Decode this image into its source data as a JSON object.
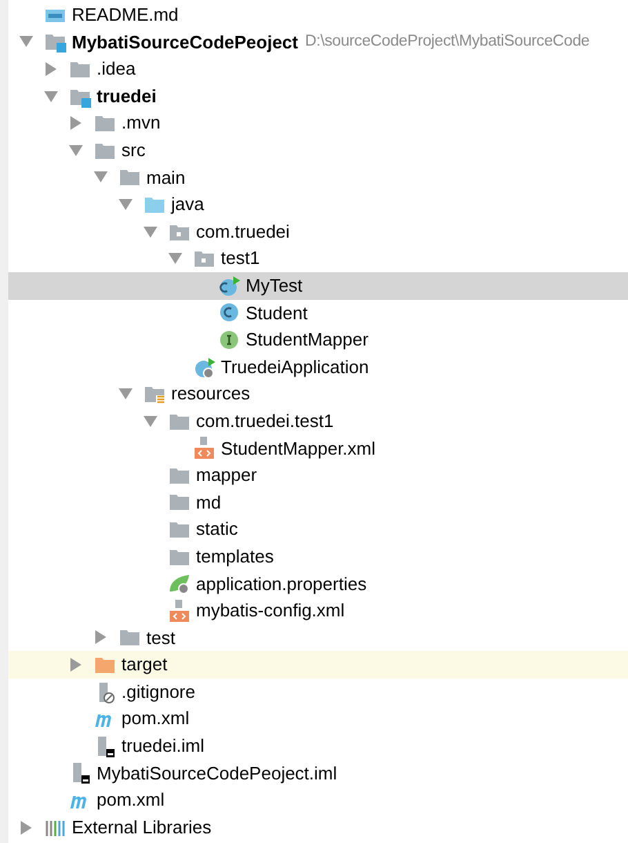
{
  "tree": [
    {
      "label": "README.md",
      "kind": "md-file",
      "selected": false,
      "highlighted": false
    },
    {
      "label": "MybatiSourceCodePeoject",
      "hint": "D:\\sourceCodeProject\\MybatiSourceCode",
      "kind": "module",
      "expanded": true,
      "selected": false,
      "highlighted": false,
      "children": [
        {
          "label": ".idea",
          "kind": "folder",
          "expanded": false,
          "selected": false,
          "highlighted": false
        },
        {
          "label": "truedei",
          "kind": "module",
          "expanded": true,
          "selected": false,
          "highlighted": false,
          "children": [
            {
              "label": ".mvn",
              "kind": "folder",
              "expanded": false,
              "selected": false,
              "highlighted": false
            },
            {
              "label": "src",
              "kind": "folder",
              "expanded": true,
              "selected": false,
              "highlighted": false,
              "children": [
                {
                  "label": "main",
                  "kind": "folder",
                  "expanded": true,
                  "selected": false,
                  "highlighted": false,
                  "children": [
                    {
                      "label": "java",
                      "kind": "source-folder",
                      "expanded": true,
                      "selected": false,
                      "highlighted": false,
                      "children": [
                        {
                          "label": "com.truedei",
                          "kind": "package",
                          "expanded": true,
                          "selected": false,
                          "highlighted": false,
                          "children": [
                            {
                              "label": "test1",
                              "kind": "package",
                              "expanded": true,
                              "selected": false,
                              "highlighted": false,
                              "children": [
                                {
                                  "label": "MyTest",
                                  "kind": "runnable-class",
                                  "selected": true,
                                  "highlighted": false
                                },
                                {
                                  "label": "Student",
                                  "kind": "class",
                                  "selected": false,
                                  "highlighted": false
                                },
                                {
                                  "label": "StudentMapper",
                                  "kind": "interface",
                                  "selected": false,
                                  "highlighted": false
                                }
                              ]
                            },
                            {
                              "label": "TruedeiApplication",
                              "kind": "spring-class",
                              "selected": false,
                              "highlighted": false
                            }
                          ]
                        }
                      ]
                    },
                    {
                      "label": "resources",
                      "kind": "resources-folder",
                      "expanded": true,
                      "selected": false,
                      "highlighted": false,
                      "children": [
                        {
                          "label": "com.truedei.test1",
                          "kind": "folder",
                          "expanded": true,
                          "selected": false,
                          "highlighted": false,
                          "children": [
                            {
                              "label": "StudentMapper.xml",
                              "kind": "xml-file",
                              "selected": false,
                              "highlighted": false
                            }
                          ]
                        },
                        {
                          "label": "mapper",
                          "kind": "folder",
                          "selected": false,
                          "highlighted": false
                        },
                        {
                          "label": "md",
                          "kind": "folder",
                          "selected": false,
                          "highlighted": false
                        },
                        {
                          "label": "static",
                          "kind": "folder",
                          "selected": false,
                          "highlighted": false
                        },
                        {
                          "label": "templates",
                          "kind": "folder",
                          "selected": false,
                          "highlighted": false
                        },
                        {
                          "label": "application.properties",
                          "kind": "properties-file",
                          "selected": false,
                          "highlighted": false
                        },
                        {
                          "label": "mybatis-config.xml",
                          "kind": "xml-file",
                          "selected": false,
                          "highlighted": false
                        }
                      ]
                    }
                  ]
                },
                {
                  "label": "test",
                  "kind": "folder",
                  "expanded": false,
                  "selected": false,
                  "highlighted": false
                }
              ]
            },
            {
              "label": "target",
              "kind": "excluded-folder",
              "expanded": false,
              "selected": false,
              "highlighted": true
            },
            {
              "label": ".gitignore",
              "kind": "ignore-file",
              "selected": false,
              "highlighted": false
            },
            {
              "label": "pom.xml",
              "kind": "maven-file",
              "selected": false,
              "highlighted": false
            },
            {
              "label": "truedei.iml",
              "kind": "iml-file",
              "selected": false,
              "highlighted": false
            }
          ]
        },
        {
          "label": "MybatiSourceCodePeoject.iml",
          "kind": "iml-file",
          "selected": false,
          "highlighted": false
        },
        {
          "label": "pom.xml",
          "kind": "maven-file",
          "selected": false,
          "highlighted": false
        }
      ]
    },
    {
      "label": "External Libraries",
      "kind": "libraries",
      "expanded": false,
      "selected": false,
      "highlighted": false
    }
  ]
}
